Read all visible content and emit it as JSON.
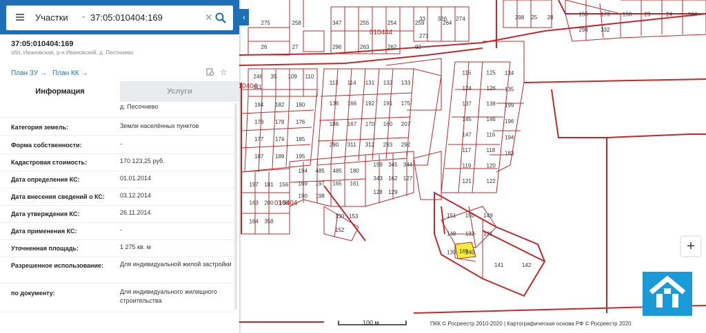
{
  "search": {
    "layer": "Участки",
    "value": "37:05:010404:169"
  },
  "parcel": {
    "id": "37:05:010404:169",
    "address": "обл. Ивановская, р-н Ивановский, д. Песочнево"
  },
  "links": {
    "plan_zu": "План ЗУ →",
    "plan_kk": "План КК →"
  },
  "tabs": {
    "info": "Информация",
    "services": "Услуги"
  },
  "info_rows": [
    {
      "key": "",
      "value": "д. Песочнево"
    },
    {
      "key": "Категория земель:",
      "value": "Земли населённых пунктов"
    },
    {
      "key": "Форма собственности:",
      "value": "-"
    },
    {
      "key": "Кадастровая стоимость:",
      "value": "170 123,25 руб."
    },
    {
      "key": "Дата определения КС:",
      "value": "01.01.2014"
    },
    {
      "key": "Дата внесения сведений о КС:",
      "value": "03.12.2014"
    },
    {
      "key": "Дата утверждения КС:",
      "value": "26.11.2014"
    },
    {
      "key": "Дата применения КС:",
      "value": "-"
    },
    {
      "key": "Уточненная площадь:",
      "value": "1 275 кв. м"
    },
    {
      "key": "Разрешенное использование:",
      "value": "Для индивидуальной жилой застройки"
    },
    {
      "key": "по документу:",
      "value": "Для индивидуального жилищного строительства"
    }
  ],
  "map": {
    "quarter_labels": [
      "010444",
      "010404",
      "010404"
    ],
    "scale": "100 м",
    "attribution": "ПКК © Росреестр 2010-2020 | Картографическая основа РФ © Росреестр 2020",
    "zoom_in": "+",
    "selected_parcel": "169",
    "parcel_colors": {
      "boundary": "#c0282d",
      "selected_fill": "#f5ee3a",
      "panel_accent": "#1f6fb7"
    },
    "parcel_numbers": [
      "275",
      "258",
      "26",
      "27",
      "347",
      "255",
      "254",
      "259",
      "264",
      "296",
      "263",
      "262",
      "92",
      "33",
      "326",
      "274",
      "273",
      "398",
      "25",
      "28",
      "155",
      "173",
      "158",
      "23",
      "24",
      "104",
      "298",
      "332",
      "246",
      "35",
      "109",
      "110",
      "111",
      "113",
      "114",
      "131",
      "132",
      "133",
      "136",
      "166",
      "192",
      "191",
      "175",
      "186",
      "167",
      "170",
      "160",
      "207",
      "290",
      "311",
      "312",
      "293",
      "292",
      "115",
      "125",
      "124",
      "126",
      "137",
      "138",
      "145",
      "146",
      "147",
      "116",
      "117",
      "118",
      "119",
      "120",
      "121",
      "122",
      "134",
      "135",
      "199",
      "196",
      "194",
      "183",
      "184",
      "182",
      "180",
      "179",
      "178",
      "176",
      "177",
      "174",
      "185",
      "187",
      "189",
      "195",
      "197",
      "181",
      "156",
      "163",
      "200",
      "168",
      "164",
      "358",
      "194",
      "485",
      "485",
      "180",
      "169",
      "197",
      "165",
      "161",
      "190",
      "198",
      "159",
      "345",
      "344",
      "343",
      "162",
      "127",
      "128",
      "129",
      "130",
      "153",
      "152",
      "151",
      "150",
      "149",
      "148",
      "132",
      "131",
      "139",
      "140",
      "141",
      "142",
      "143",
      "144",
      "247",
      "279",
      "272",
      "271",
      "270",
      "226",
      "225",
      "221",
      "229",
      "326",
      "303",
      "280",
      "213",
      "249",
      "299",
      "300",
      "281",
      "230",
      "335",
      "248",
      "212",
      "273",
      "274",
      "310",
      "219",
      "220"
    ]
  }
}
